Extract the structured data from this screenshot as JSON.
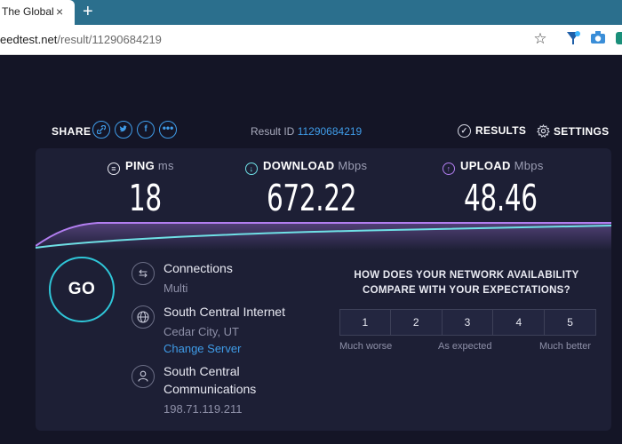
{
  "browser": {
    "tab_title": "The Global",
    "tab_close": "×",
    "new_tab": "+",
    "url_host": "eedtest.net",
    "url_path": "/result/11290684219",
    "toolbar_icons": [
      "star-icon",
      "funnel-icon",
      "camera-icon",
      "extension-icon"
    ]
  },
  "header": {
    "share_label": "SHARE",
    "share_icons": [
      "link-icon",
      "twitter-icon",
      "facebook-icon",
      "more-icon"
    ],
    "result_id_label": "Result ID",
    "result_id": "11290684219",
    "results_label": "RESULTS",
    "settings_label": "SETTINGS"
  },
  "metrics": {
    "ping": {
      "label": "PING",
      "unit": "ms",
      "value": "18"
    },
    "download": {
      "label": "DOWNLOAD",
      "unit": "Mbps",
      "value": "672.22"
    },
    "upload": {
      "label": "UPLOAD",
      "unit": "Mbps",
      "value": "48.46"
    }
  },
  "colors": {
    "accent_blue": "#3f9ce8",
    "download_cyan": "#6fe0e6",
    "upload_purple": "#b27ef0",
    "go_ring": "#2fc6d8",
    "page_bg": "#141526",
    "panel_bg": "#1d1f35"
  },
  "go_button": {
    "label": "GO"
  },
  "connection": {
    "connections_title": "Connections",
    "connections_value": "Multi",
    "server_name": "South Central Internet",
    "server_location": "Cedar City, UT",
    "change_server": "Change Server",
    "isp_line1": "South Central",
    "isp_line2": "Communications",
    "ip": "198.71.119.211"
  },
  "survey": {
    "question_line1": "HOW DOES YOUR NETWORK AVAILABILITY",
    "question_line2": "COMPARE WITH YOUR EXPECTATIONS?",
    "ratings": [
      "1",
      "2",
      "3",
      "4",
      "5"
    ],
    "low_label": "Much worse",
    "mid_label": "As expected",
    "high_label": "Much better"
  }
}
